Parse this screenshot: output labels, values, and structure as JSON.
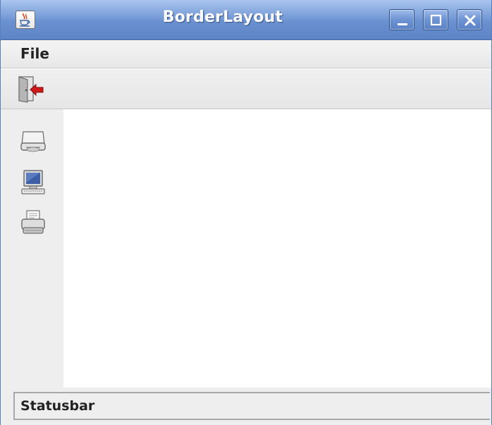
{
  "window": {
    "title": "BorderLayout",
    "app_icon": "java-coffee-cup-icon",
    "controls": {
      "minimize_icon": "minimize-icon",
      "maximize_icon": "maximize-icon",
      "close_icon": "close-icon"
    }
  },
  "menubar": {
    "items": [
      {
        "label": "File"
      }
    ]
  },
  "toolbar": {
    "buttons": [
      {
        "icon": "exit-door-icon"
      }
    ]
  },
  "sidebar": {
    "buttons": [
      {
        "icon": "drive-icon"
      },
      {
        "icon": "computer-icon"
      },
      {
        "icon": "printer-icon"
      }
    ]
  },
  "statusbar": {
    "text": "Statusbar"
  },
  "colors": {
    "titlebar": "#6a90d0",
    "background": "#eeeeee",
    "text_area": "#ffffff"
  }
}
